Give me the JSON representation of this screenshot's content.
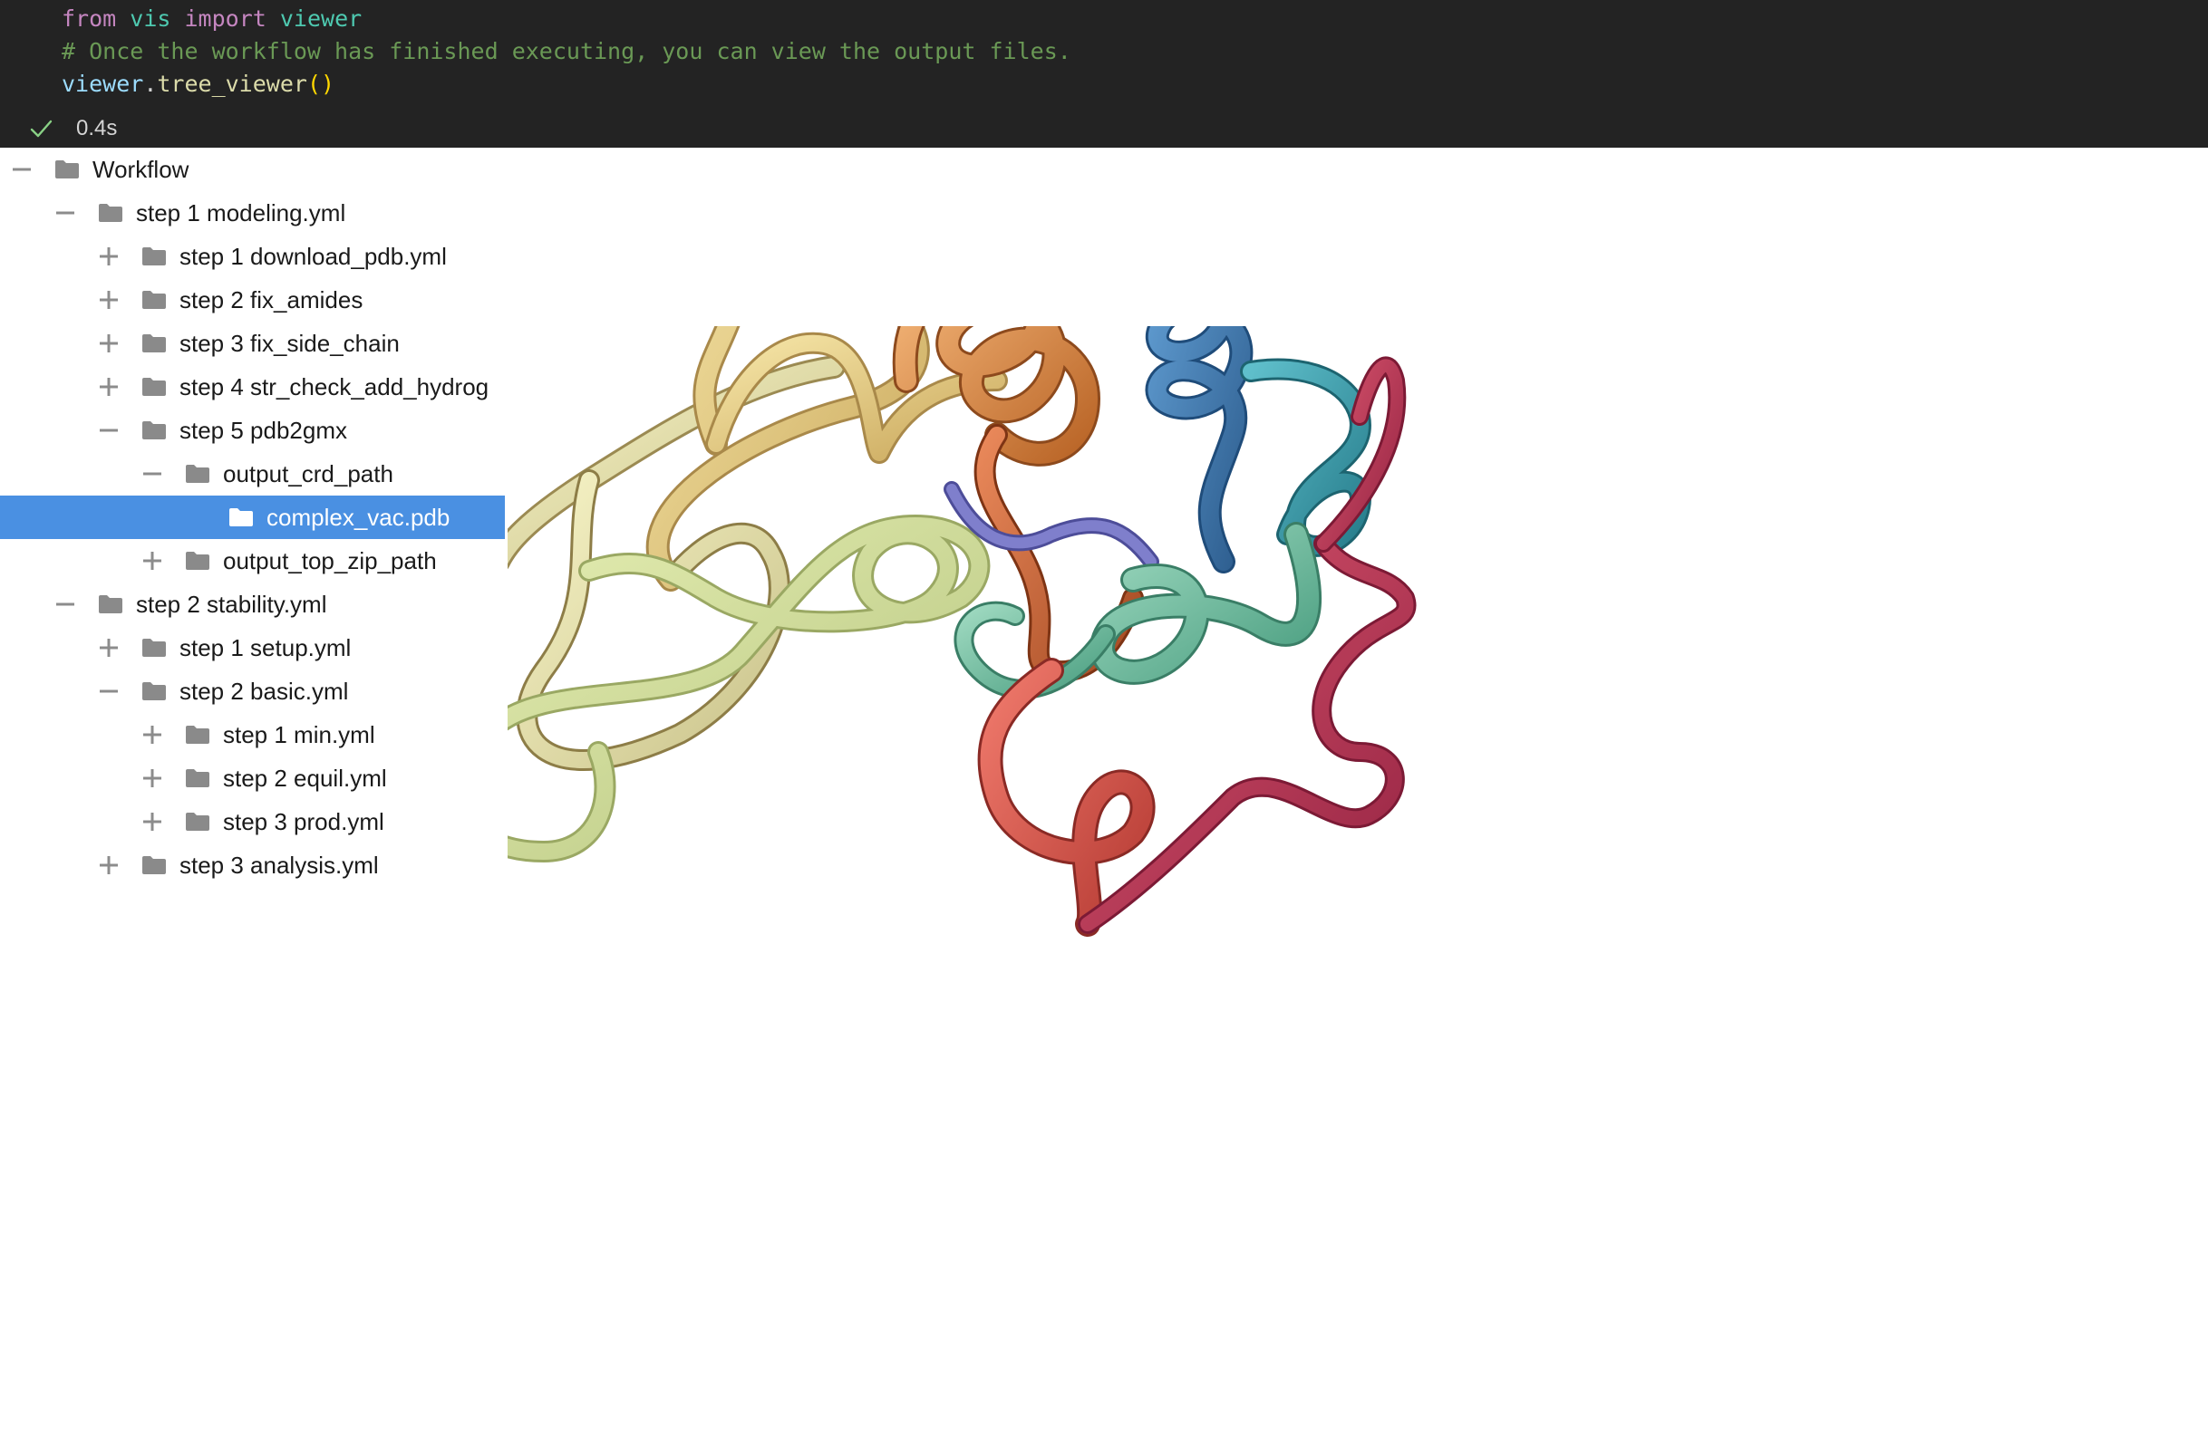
{
  "code_cell": {
    "lines": [
      {
        "tokens": [
          "from",
          " ",
          "vis",
          " ",
          "import",
          " ",
          "viewer"
        ]
      },
      {
        "comment": "# Once the workflow has finished executing, you can view the output files."
      },
      {
        "tokens": [
          "viewer",
          ".",
          "tree_viewer",
          "()"
        ]
      }
    ],
    "status": {
      "icon": "check-icon",
      "time": "0.4s"
    }
  },
  "tree": {
    "nodes": [
      {
        "label": "Workflow",
        "depth": 0,
        "toggle": "minus"
      },
      {
        "label": "step 1 modeling.yml",
        "depth": 1,
        "toggle": "minus"
      },
      {
        "label": "step 1 download_pdb.yml",
        "depth": 2,
        "toggle": "plus"
      },
      {
        "label": "step 2 fix_amides",
        "depth": 2,
        "toggle": "plus"
      },
      {
        "label": "step 3 fix_side_chain",
        "depth": 2,
        "toggle": "plus"
      },
      {
        "label": "step 4 str_check_add_hydrog",
        "depth": 2,
        "toggle": "plus"
      },
      {
        "label": "step 5 pdb2gmx",
        "depth": 2,
        "toggle": "minus"
      },
      {
        "label": "output_crd_path",
        "depth": 3,
        "toggle": "minus"
      },
      {
        "label": "complex_vac.pdb",
        "depth": 4,
        "toggle": "none",
        "selected": true
      },
      {
        "label": "output_top_zip_path",
        "depth": 3,
        "toggle": "plus"
      },
      {
        "label": "step 2 stability.yml",
        "depth": 1,
        "toggle": "minus"
      },
      {
        "label": "step 1 setup.yml",
        "depth": 2,
        "toggle": "plus"
      },
      {
        "label": "step 2 basic.yml",
        "depth": 2,
        "toggle": "minus"
      },
      {
        "label": "step 1 min.yml",
        "depth": 3,
        "toggle": "plus"
      },
      {
        "label": "step 2 equil.yml",
        "depth": 3,
        "toggle": "plus"
      },
      {
        "label": "step 3 prod.yml",
        "depth": 3,
        "toggle": "plus"
      },
      {
        "label": "step 3 analysis.yml",
        "depth": 2,
        "toggle": "plus"
      }
    ]
  },
  "viewer": {
    "content": "protein-ribbon-structure",
    "colors": {
      "selection": "#4a90e2",
      "folder_icon": "#8a8a8a",
      "folder_icon_selected": "#ffffff",
      "code_background": "#232323",
      "ribbon_palette": [
        "#f3dc97",
        "#f0eebc",
        "#d9e8a8",
        "#e89a4f",
        "#cf6a3a",
        "#6f6fbd",
        "#3f7fb6",
        "#3aa0b0",
        "#72c3a4",
        "#e2574c",
        "#c23b56"
      ]
    }
  }
}
